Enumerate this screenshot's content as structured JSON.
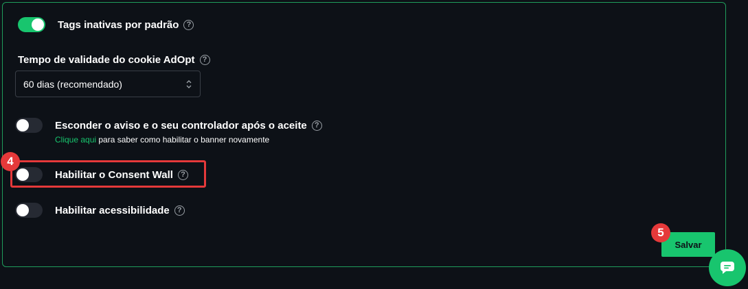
{
  "colors": {
    "accent": "#18c56e",
    "background": "#0d1117",
    "annotation": "#e5393a"
  },
  "settings": {
    "tags_inactive": {
      "label": "Tags inativas por padrão",
      "enabled": true
    },
    "cookie_validity": {
      "label": "Tempo de validade do cookie AdOpt",
      "selected": "60 dias (recomendado)"
    },
    "hide_notice": {
      "label": "Esconder o aviso e o seu controlador após o aceite",
      "enabled": false,
      "link_text": "Clique aqui",
      "link_suffix": " para saber como habilitar o banner novamente"
    },
    "consent_wall": {
      "label": "Habilitar o Consent Wall",
      "enabled": false
    },
    "accessibility": {
      "label": "Habilitar acessibilidade",
      "enabled": false
    }
  },
  "help_glyph": "?",
  "annotations": {
    "step4": "4",
    "step5": "5"
  },
  "actions": {
    "save_label": "Salvar"
  },
  "icons": {
    "help": "question-circle-icon",
    "select_arrows": "sort-arrows-icon",
    "chat": "chat-bubble-icon"
  }
}
